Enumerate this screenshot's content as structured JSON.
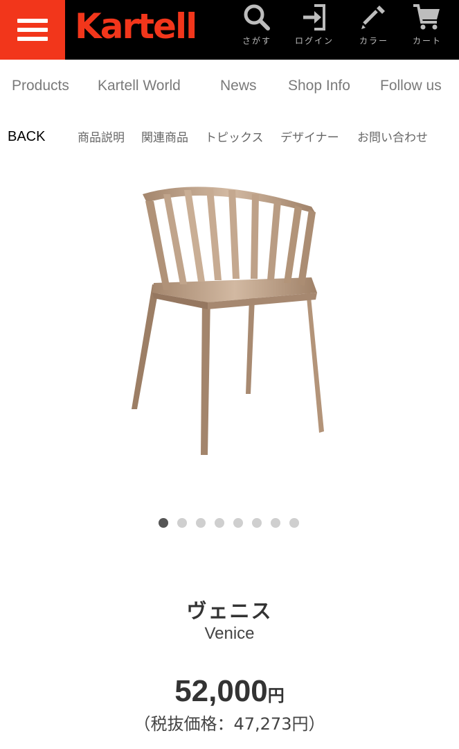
{
  "header": {
    "logo": "Kartell",
    "icons": [
      {
        "name": "search-icon",
        "label": "さがす"
      },
      {
        "name": "login-icon",
        "label": "ログイン"
      },
      {
        "name": "color-dropper-icon",
        "label": "カラー"
      },
      {
        "name": "cart-icon",
        "label": "カート"
      }
    ],
    "brand_color": "#f2361b"
  },
  "main_nav": [
    "Products",
    "Kartell World",
    "News",
    "Shop Info",
    "Follow us"
  ],
  "sub_nav": {
    "back": "BACK",
    "items": [
      "商品説明",
      "関連商品",
      "トピックス",
      "デザイナー",
      "お問い合わせ"
    ]
  },
  "carousel": {
    "total": 8,
    "active": 1
  },
  "product": {
    "name_jp": "ヴェニス",
    "name_en": "Venice",
    "price": "52,000",
    "currency": "円",
    "price_tax": "（税抜価格：47,273円）",
    "color": "#b89a80"
  }
}
